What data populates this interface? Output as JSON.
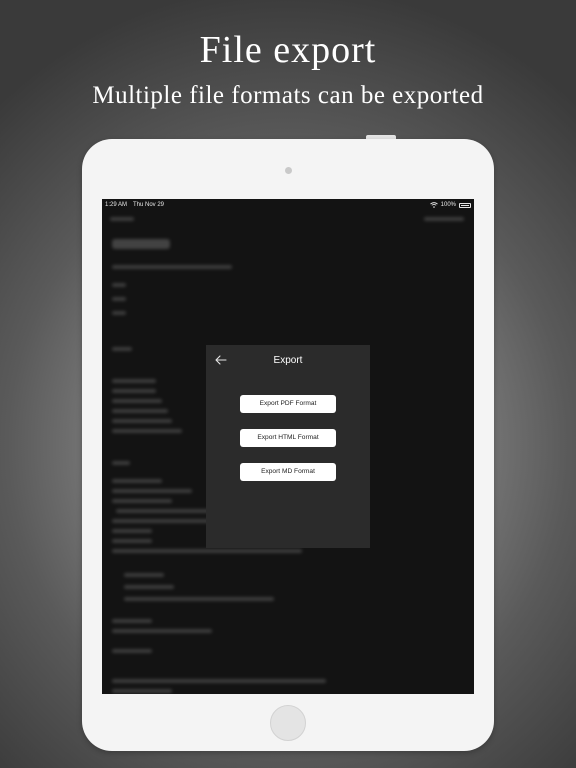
{
  "headline": {
    "title": "File export",
    "subtitle": "Multiple file formats can be exported"
  },
  "statusbar": {
    "time": "1:29 AM",
    "date": "Thu Nov 29",
    "battery": "100%",
    "icons": [
      "wifi-icon",
      "battery-icon"
    ]
  },
  "dialog": {
    "title": "Export",
    "back_icon": "arrow-left-icon",
    "buttons": {
      "pdf": "Export PDF Format",
      "html": "Export HTML Format",
      "md": "Export MD Format"
    }
  },
  "colors": {
    "dialog_bg": "#2b2b2b",
    "screen_bg": "#131313",
    "button_bg": "#ffffff"
  }
}
